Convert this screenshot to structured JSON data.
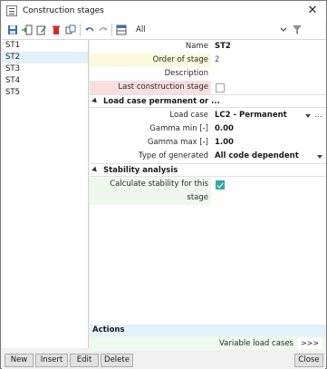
{
  "window": {
    "title": "Construction stages",
    "close_glyph": "✕"
  },
  "toolbar": {
    "filter_text": "All"
  },
  "stages": [
    "ST1",
    "ST2",
    "ST3",
    "ST4",
    "ST5"
  ],
  "selected_stage": "ST2",
  "properties": {
    "name": {
      "label": "Name",
      "value": "ST2"
    },
    "order": {
      "label": "Order of stage",
      "value": "2"
    },
    "description": {
      "label": "Description",
      "value": ""
    },
    "last_stage": {
      "label": "Last construction stage",
      "checked": false
    },
    "section_load": "Load case permanent or ...",
    "load_case": {
      "label": "Load case",
      "value": "LC2 - Permanent",
      "more": "..."
    },
    "gamma_min": {
      "label": "Gamma min [-]",
      "value": "0.00"
    },
    "gamma_max": {
      "label": "Gamma max [-]",
      "value": "1.00"
    },
    "gen_comb": {
      "label": "Type of generated combinations",
      "value": "All code dependent"
    },
    "section_stability": "Stability analysis",
    "calc_stability": {
      "label": "Calculate stability for this stage",
      "checked": true
    }
  },
  "actions": {
    "title": "Actions",
    "variable_load_cases": "Variable load cases",
    "button": ">>>"
  },
  "buttons": {
    "new": "New",
    "insert": "Insert",
    "edit": "Edit",
    "delete": "Delete",
    "close": "Close"
  },
  "colors": {
    "selection": "#e3f1fb",
    "checkbox_accent": "#35a7a0",
    "pink_tint": "#f9dede",
    "yellow_tint": "#fbf9dc",
    "green_tint": "#eef8ec"
  }
}
